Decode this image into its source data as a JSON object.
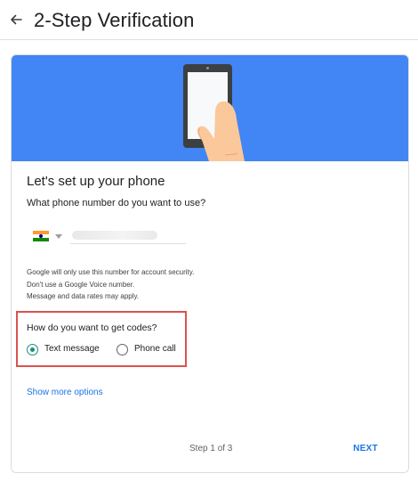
{
  "header": {
    "title": "2-Step Verification"
  },
  "icons": {
    "back": "arrow-back-icon",
    "phone_illustration": "phone-in-hand-illustration",
    "flag": "india-flag-icon"
  },
  "colors": {
    "banner": "#4285f4",
    "accent_blue": "#1a73e8",
    "radio_selected": "#1a8e7a",
    "highlight_border": "#d9534f"
  },
  "card": {
    "heading": "Let's set up your phone",
    "phone_question": "What phone number do you want to use?",
    "country": {
      "selected": "India",
      "flag": "india-flag-icon"
    },
    "info_lines": [
      "Google will only use this number for account security.",
      "Don't use a Google Voice number.",
      "Message and data rates may apply."
    ],
    "codes_question": "How do you want to get codes?",
    "code_options": [
      {
        "label": "Text message",
        "selected": true
      },
      {
        "label": "Phone call",
        "selected": false
      }
    ],
    "show_more": "Show more options",
    "step": "Step 1 of 3",
    "next_label": "NEXT"
  }
}
